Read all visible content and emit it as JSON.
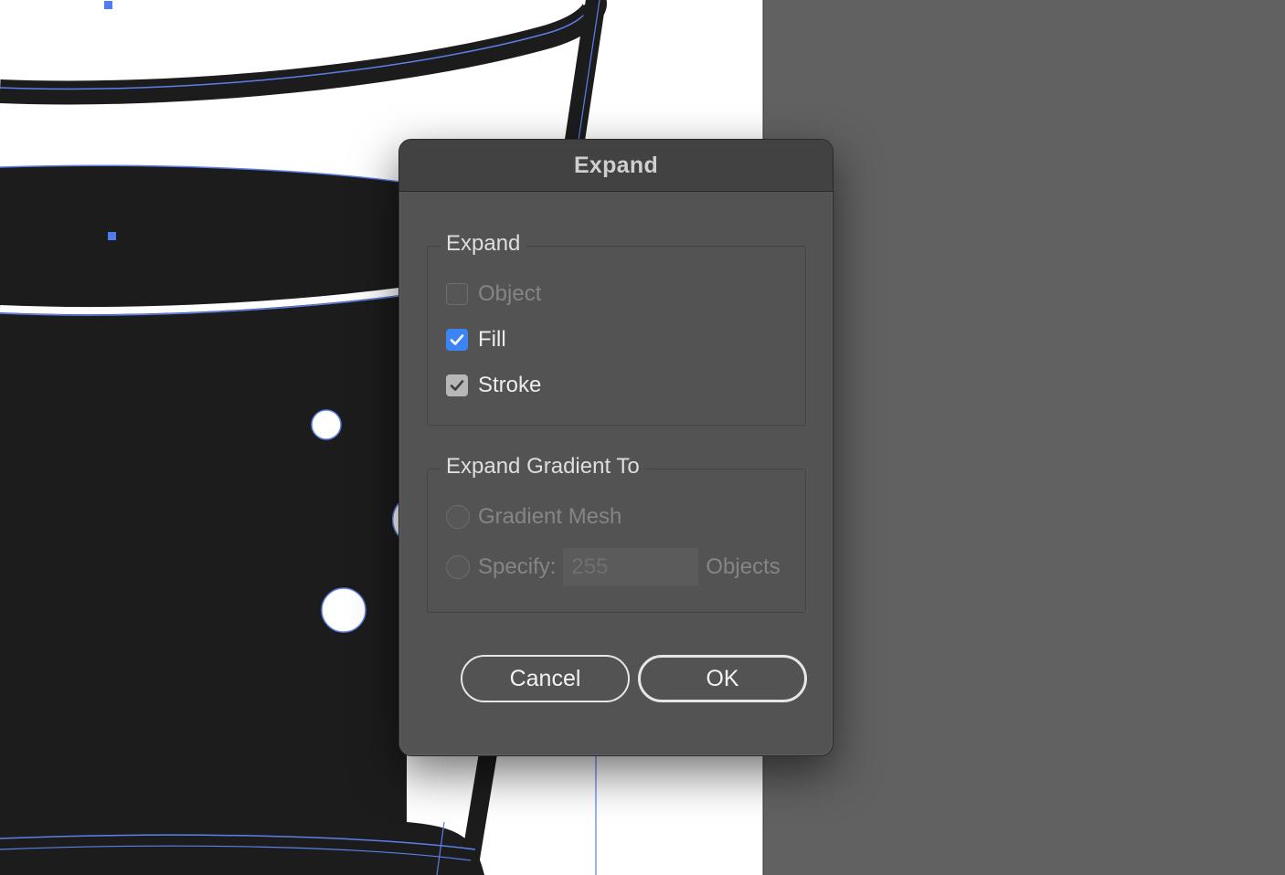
{
  "dialog": {
    "title": "Expand",
    "expand_group": {
      "label": "Expand",
      "options": [
        {
          "label": "Object",
          "checked": false,
          "enabled": false
        },
        {
          "label": "Fill",
          "checked": true,
          "enabled": true
        },
        {
          "label": "Stroke",
          "checked": true,
          "enabled": true
        }
      ]
    },
    "gradient_group": {
      "label": "Expand Gradient To",
      "mesh_label": "Gradient Mesh",
      "specify_label": "Specify:",
      "specify_value": "255",
      "objects_label": "Objects"
    },
    "buttons": {
      "cancel": "Cancel",
      "ok": "OK"
    }
  },
  "colors": {
    "accent": "#3c84f3",
    "selection": "#5b7fe8",
    "dialog_bg": "#535353",
    "pasteboard": "#616161",
    "artwork": "#1c1c1c"
  }
}
